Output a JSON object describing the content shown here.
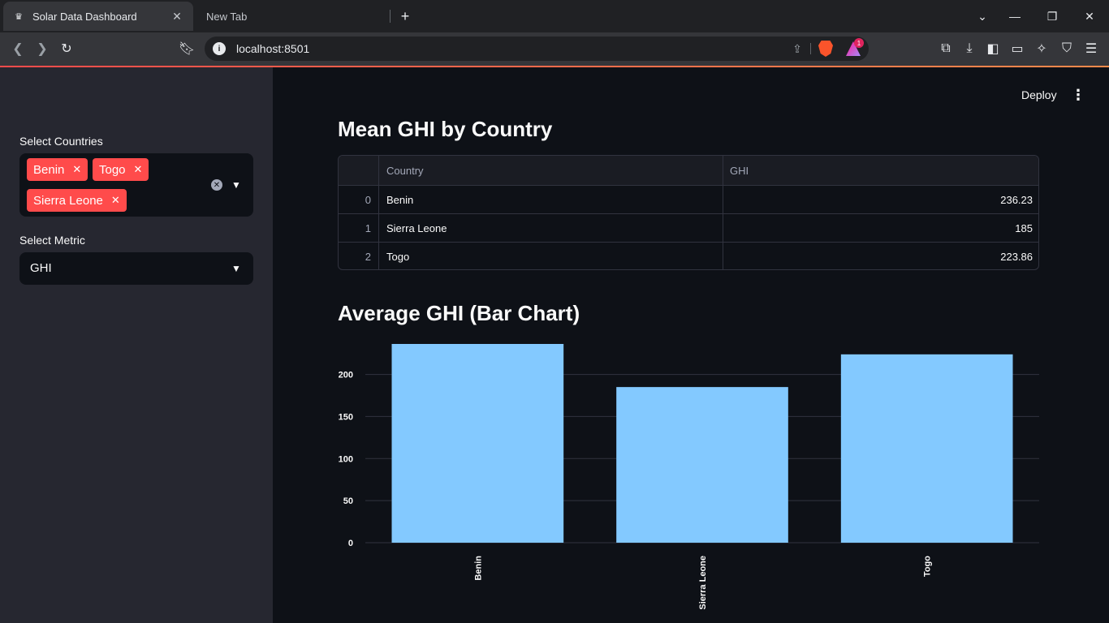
{
  "browser": {
    "tabs": [
      {
        "title": "Solar Data Dashboard",
        "active": true
      },
      {
        "title": "New Tab",
        "active": false
      }
    ],
    "url": "localhost:8501",
    "rewards_badge": "1"
  },
  "sidebar": {
    "countries_label": "Select Countries",
    "selected_countries": [
      "Benin",
      "Togo",
      "Sierra Leone"
    ],
    "metric_label": "Select Metric",
    "metric_value": "GHI"
  },
  "header": {
    "deploy_label": "Deploy"
  },
  "table_section": {
    "title": "Mean GHI by Country",
    "columns": [
      "",
      "Country",
      "GHI"
    ],
    "rows": [
      [
        "0",
        "Benin",
        "236.23"
      ],
      [
        "1",
        "Sierra Leone",
        "185"
      ],
      [
        "2",
        "Togo",
        "223.86"
      ]
    ]
  },
  "chart_section": {
    "title": "Average GHI (Bar Chart)"
  },
  "chart_data": {
    "type": "bar",
    "categories": [
      "Benin",
      "Sierra Leone",
      "Togo"
    ],
    "values": [
      236.23,
      185,
      223.86
    ],
    "title": "",
    "xlabel": "",
    "ylabel": "",
    "yticks": [
      0,
      50,
      100,
      150,
      200
    ],
    "ylim": [
      0,
      236.23
    ],
    "grid": true,
    "bar_color": "#83c9ff",
    "grid_color": "#31333f"
  },
  "colors": {
    "accent": "#ff4b4b",
    "sidebar_bg": "#262730",
    "main_bg": "#0e1117"
  }
}
